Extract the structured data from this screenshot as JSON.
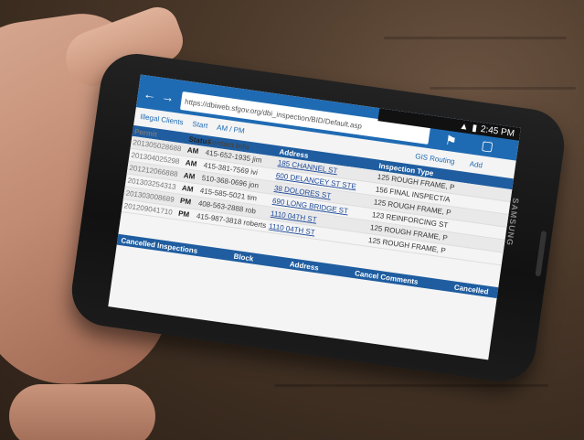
{
  "browser": {
    "url": "https://dbiweb.sfgov.org/dbi_inspection/BID/Default.asp",
    "time": "2:45 PM",
    "back": "←",
    "forward": "→"
  },
  "tabs": [
    "Illegal Clients",
    "Start",
    "AM / PM"
  ],
  "links": {
    "gis": "GIS Routing",
    "add": "Add"
  },
  "table": {
    "headers": [
      "Permit",
      "Status",
      "Contact Info",
      "Address",
      "Inspection Type"
    ],
    "rows": [
      {
        "permit": "201305028688",
        "status": "AM",
        "contact": "415-652-1935 jim",
        "address": "185 CHANNEL ST",
        "type": "125 ROUGH FRAME, P"
      },
      {
        "permit": "201304025298",
        "status": "AM",
        "contact": "415-381-7569 ivi",
        "address": "600 DELANCEY ST STE",
        "type": "156 FINAL INSPECT/A"
      },
      {
        "permit": "201212066888",
        "status": "AM",
        "contact": "510-368-0696 jon",
        "address": "38 DOLORES ST",
        "type": "125 ROUGH FRAME, P"
      },
      {
        "permit": "201303254313",
        "status": "AM",
        "contact": "415-585-5021 tim",
        "address": "690 LONG BRIDGE ST",
        "type": "123 REINFORCING ST"
      },
      {
        "permit": "201303008689",
        "status": "PM",
        "contact": "408-563-2888 rob",
        "address": "1110 04TH ST",
        "type": "125 ROUGH FRAME, P"
      },
      {
        "permit": "201209041710",
        "status": "PM",
        "contact": "415-987-3818 roberts",
        "address": "1110 04TH ST",
        "type": "125 ROUGH FRAME, P"
      }
    ]
  },
  "cancel": {
    "title": "Cancelled Inspections",
    "cols": [
      "Block",
      "Address",
      "Cancel Comments",
      "Cancelled"
    ]
  },
  "phone": {
    "brand": "SAMSUNG"
  }
}
